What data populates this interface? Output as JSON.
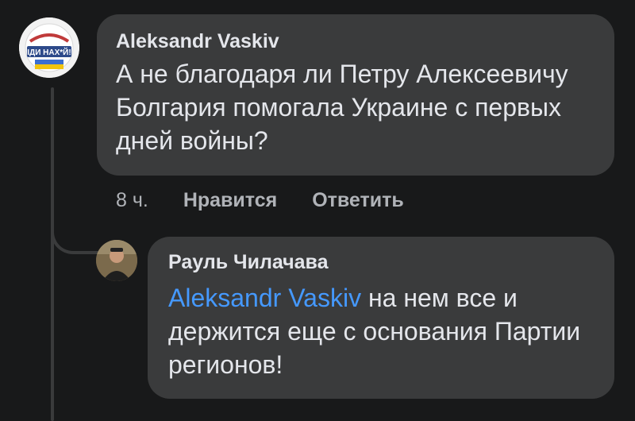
{
  "comment": {
    "author": "Aleksandr Vaskiv",
    "text": "А не благодаря ли Петру Алексеевичу Болгария помогала Украине с первых дней войны?",
    "time": "8 ч.",
    "like_label": "Нравится",
    "reply_label": "Ответить",
    "avatar_text": "ІДИ НАХ*Й!"
  },
  "reply": {
    "author": "Рауль Чилачава",
    "mention": "Aleksandr Vaskiv",
    "text": " на нем все и держится еще с основания Партии регионов!"
  },
  "colors": {
    "background": "#18191a",
    "bubble": "#3a3b3c",
    "mention": "#4599ff",
    "meta": "#b0b3b8"
  }
}
